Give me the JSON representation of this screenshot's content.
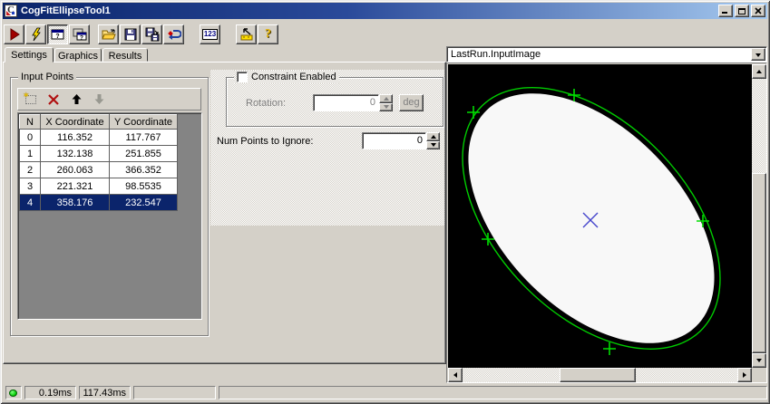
{
  "window": {
    "title": "CogFitEllipseTool1"
  },
  "toolbar": {
    "buttons": [
      {
        "name": "run-button",
        "icon": "play-icon"
      },
      {
        "name": "run-tool-button",
        "icon": "lightning-icon"
      },
      {
        "name": "show-control-button",
        "icon": "window-question-icon",
        "pressed": true
      },
      {
        "name": "float-control-button",
        "icon": "cascade-window-icon"
      },
      {
        "name": "open-button",
        "icon": "open-folder-icon"
      },
      {
        "name": "save-button",
        "icon": "floppy-icon"
      },
      {
        "name": "save-as-button",
        "icon": "floppy-arrow-icon"
      },
      {
        "name": "reset-button",
        "icon": "reset-arrow-icon"
      },
      {
        "name": "numeric-display-button",
        "icon": "123-icon"
      },
      {
        "name": "position-tool-button",
        "icon": "ruler-arrow-icon"
      },
      {
        "name": "help-button",
        "icon": "question-icon"
      }
    ],
    "numeric_glyph": "123",
    "help_glyph": "?"
  },
  "tabs": {
    "items": [
      {
        "label": "Settings",
        "active": true
      },
      {
        "label": "Graphics",
        "active": false
      },
      {
        "label": "Results",
        "active": false
      }
    ]
  },
  "input_points": {
    "title": "Input Points",
    "columns": [
      "N",
      "X Coordinate",
      "Y Coordinate"
    ],
    "rows": [
      {
        "n": "0",
        "x": "116.352",
        "y": "117.767"
      },
      {
        "n": "1",
        "x": "132.138",
        "y": "251.855"
      },
      {
        "n": "2",
        "x": "260.063",
        "y": "366.352"
      },
      {
        "n": "3",
        "x": "221.321",
        "y": "98.5535"
      },
      {
        "n": "4",
        "x": "358.176",
        "y": "232.547"
      }
    ],
    "selected_row": 4
  },
  "constraint": {
    "title": "Constraint Enabled",
    "checked": false,
    "rotation_label": "Rotation:",
    "rotation_value": "0",
    "unit_label": "deg"
  },
  "num_points_to_ignore": {
    "label": "Num Points to Ignore:",
    "value": "0"
  },
  "image_panel": {
    "selected_image": "LastRun.InputImage"
  },
  "status_bar": {
    "run_time": "0.19ms",
    "total_time": "117.43ms"
  },
  "colors": {
    "overlay_green": "#00cc00",
    "marker_green": "#00dd00",
    "center_blue": "#4444cc",
    "ellipse_white": "#f8f8f8",
    "selection_blue": "#0b246b",
    "status_led_green": "#00cc00"
  }
}
